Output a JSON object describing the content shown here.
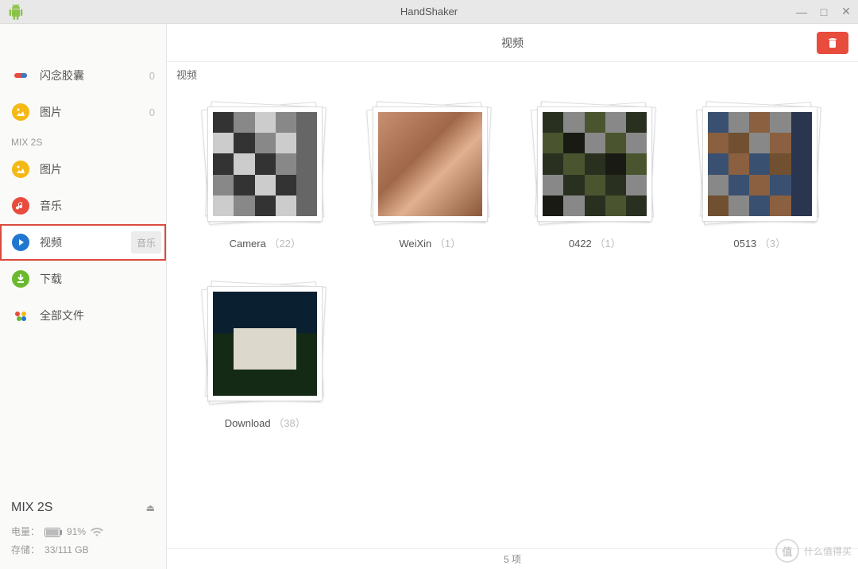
{
  "titlebar": {
    "title": "HandShaker"
  },
  "sidebar": {
    "top_items": [
      {
        "label": "闪念胶囊",
        "count": "0",
        "icon": "capsule-icon",
        "color1": "#e84c3d",
        "color2": "#3a7cc4"
      },
      {
        "label": "图片",
        "count": "0",
        "icon": "image-icon",
        "color": "#f5b915"
      }
    ],
    "section": "MIX 2S",
    "items": [
      {
        "label": "图片",
        "icon": "image-icon",
        "color": "#f5b915"
      },
      {
        "label": "音乐",
        "icon": "music-icon",
        "color": "#e84c3d"
      },
      {
        "label": "视频",
        "icon": "video-icon",
        "color": "#2176d2",
        "active": true,
        "chip": "音乐"
      },
      {
        "label": "下载",
        "icon": "download-icon",
        "color": "#6ab92e"
      },
      {
        "label": "全部文件",
        "icon": "files-icon",
        "color": ""
      }
    ],
    "footer": {
      "name": "MIX 2S",
      "battery_label": "电量：",
      "battery_pct": "91%",
      "storage_label": "存储：",
      "storage_value": "33/111 GB"
    }
  },
  "content": {
    "header_title": "视频",
    "breadcrumb": "视频",
    "folders": [
      {
        "name": "Camera",
        "count": "（22）",
        "thumb": "p1"
      },
      {
        "name": "WeiXin",
        "count": "（1）",
        "thumb": "p2"
      },
      {
        "name": "0422",
        "count": "（1）",
        "thumb": "p3"
      },
      {
        "name": "0513",
        "count": "（3）",
        "thumb": "p4"
      },
      {
        "name": "Download",
        "count": "（38）",
        "thumb": "p5"
      }
    ],
    "status": "5 项"
  },
  "watermark": {
    "badge": "值",
    "text": "什么值得买"
  }
}
